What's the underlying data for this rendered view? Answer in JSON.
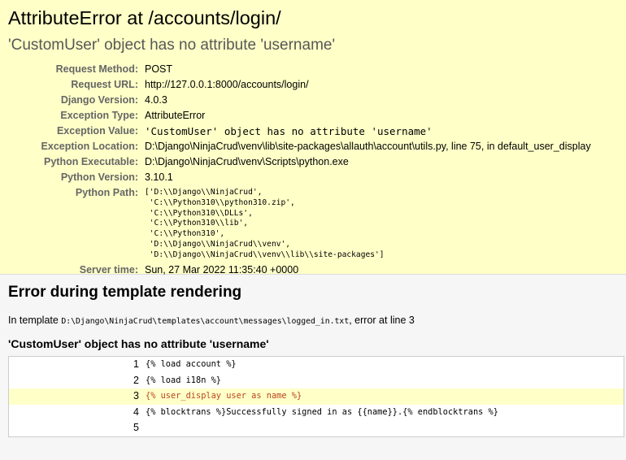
{
  "summary": {
    "title": "AttributeError at /accounts/login/",
    "subtitle": "'CustomUser' object has no attribute 'username'",
    "meta": [
      {
        "label": "Request Method:",
        "value": "POST",
        "mono": false
      },
      {
        "label": "Request URL:",
        "value": "http://127.0.0.1:8000/accounts/login/",
        "mono": false
      },
      {
        "label": "Django Version:",
        "value": "4.0.3",
        "mono": false
      },
      {
        "label": "Exception Type:",
        "value": "AttributeError",
        "mono": false
      },
      {
        "label": "Exception Value:",
        "value": "'CustomUser' object has no attribute 'username'",
        "mono": true
      },
      {
        "label": "Exception Location:",
        "value": "D:\\Django\\NinjaCrud\\venv\\lib\\site-packages\\allauth\\account\\utils.py, line 75, in default_user_display",
        "mono": false
      },
      {
        "label": "Python Executable:",
        "value": "D:\\Django\\NinjaCrud\\venv\\Scripts\\python.exe",
        "mono": false
      },
      {
        "label": "Python Version:",
        "value": "3.10.1",
        "mono": false
      }
    ],
    "python_path_label": "Python Path:",
    "python_path": "['D:\\\\Django\\\\NinjaCrud',\n 'C:\\\\Python310\\\\python310.zip',\n 'C:\\\\Python310\\\\DLLs',\n 'C:\\\\Python310\\\\lib',\n 'C:\\\\Python310',\n 'D:\\\\Django\\\\NinjaCrud\\\\venv',\n 'D:\\\\Django\\\\NinjaCrud\\\\venv\\\\lib\\\\site-packages']",
    "server_time_label": "Server time:",
    "server_time": "Sun, 27 Mar 2022 11:35:40 +0000"
  },
  "template": {
    "heading": "Error during template rendering",
    "intro_prefix": "In template",
    "template_path": "D:\\Django\\NinjaCrud\\templates\\account\\messages\\logged_in.txt",
    "intro_suffix": ", error at line 3",
    "error_message": "'CustomUser' object has no attribute 'username'",
    "source_lines": [
      {
        "num": "1",
        "code": "{% load account %}",
        "highlight": false
      },
      {
        "num": "2",
        "code": "{% load i18n %}",
        "highlight": false
      },
      {
        "num": "3",
        "code": "{% user_display user as name %}",
        "highlight": true
      },
      {
        "num": "4",
        "code": "{% blocktrans %}Successfully signed in as {{name}}.{% endblocktrans %}",
        "highlight": false
      },
      {
        "num": "5",
        "code": "",
        "highlight": false
      }
    ]
  },
  "colors": {
    "summary_bg": "#ffffc8",
    "highlight_text": "#b8451c",
    "label": "#666666"
  }
}
